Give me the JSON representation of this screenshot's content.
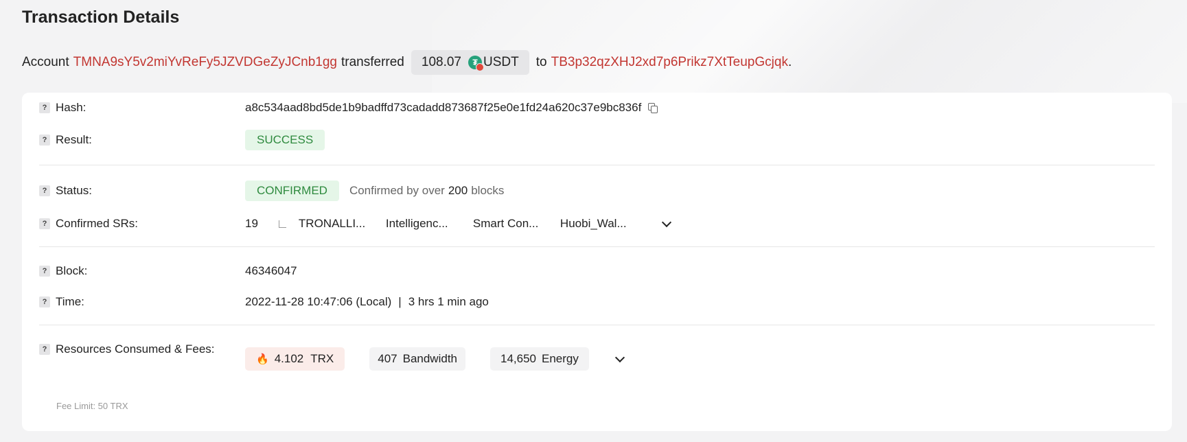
{
  "page": {
    "title": "Transaction Details"
  },
  "summary": {
    "prefix": "Account",
    "from_address": "TMNA9sY5v2miYvReFy5JZVDGeZyJCnb1gg",
    "verb": "transferred",
    "amount": "108.07",
    "token_symbol": "USDT",
    "token_icon": "tether-icon",
    "to_word": "to",
    "to_address": "TB3p32qzXHJ2xd7p6Prikz7XtTeupGcjqk",
    "end": "."
  },
  "details": {
    "hash_label": "Hash:",
    "hash_value": "a8c534aad8bd5de1b9badffd73cadadd873687f25e0e1fd24a620c37e9bc836f",
    "result_label": "Result:",
    "result_value": "SUCCESS",
    "status_label": "Status:",
    "status_value": "CONFIRMED",
    "status_note_prefix": "Confirmed by over",
    "status_note_count": "200",
    "status_note_suffix": "blocks",
    "srs_label": "Confirmed SRs:",
    "srs_count": "19",
    "srs": [
      "TRONALLI...",
      "Intelligenc...",
      "Smart Con...",
      "Huobi_Wal..."
    ],
    "block_label": "Block:",
    "block_value": "46346047",
    "time_label": "Time:",
    "time_value": "2022-11-28 10:47:06 (Local)",
    "time_sep": "|",
    "time_ago": "3 hrs 1 min ago",
    "resources_label": "Resources Consumed & Fees:",
    "fee_limit": "Fee Limit: 50 TRX",
    "fee_trx_value": "4.102",
    "fee_trx_unit": "TRX",
    "bandwidth_value": "407",
    "bandwidth_unit": "Bandwidth",
    "energy_value": "14,650",
    "energy_unit": "Energy",
    "help_glyph": "?"
  },
  "colors": {
    "link_red": "#c23631",
    "success_green": "#2e8a3e",
    "success_bg": "#e5f6e8",
    "tether_green": "#26a17b"
  }
}
